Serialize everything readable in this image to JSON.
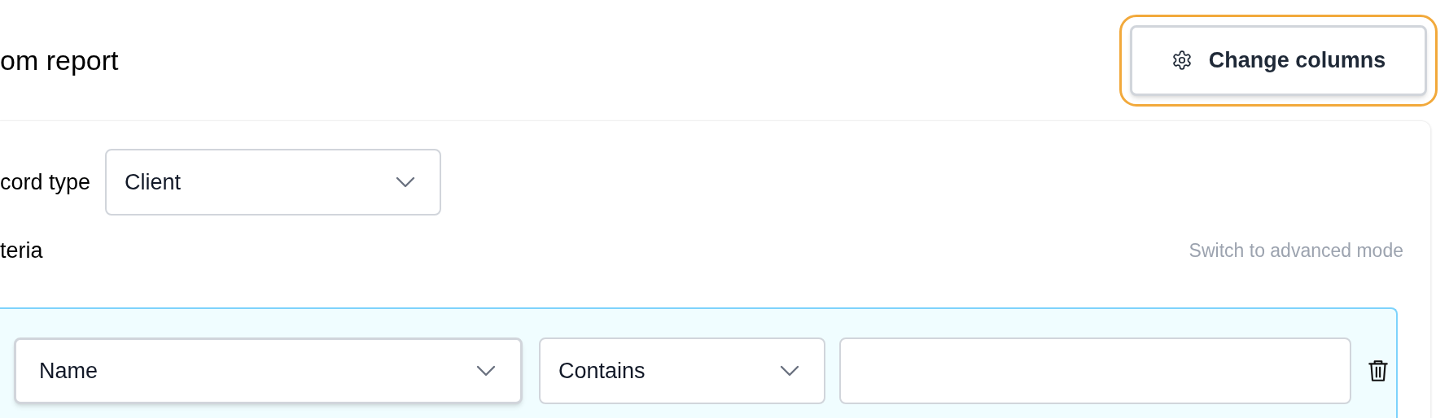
{
  "header": {
    "title": "om report",
    "change_columns_button": {
      "label": "Change columns",
      "focused": true
    }
  },
  "record_type": {
    "label": "cord type",
    "value": "Client"
  },
  "criteria": {
    "label": "teria",
    "switch_link": "Switch to advanced mode",
    "rows": [
      {
        "field": {
          "value": "Name",
          "focused": true
        },
        "operator": {
          "value": "Contains",
          "focused": false
        }
      }
    ]
  }
}
